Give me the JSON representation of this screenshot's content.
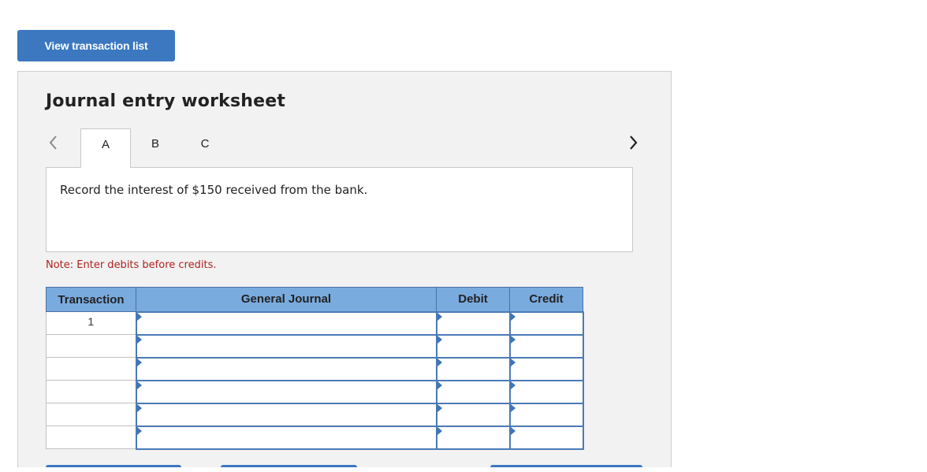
{
  "view_button": {
    "label": "View transaction list"
  },
  "worksheet": {
    "title": "Journal entry worksheet",
    "tabs": [
      {
        "label": "A",
        "active": true
      },
      {
        "label": "B",
        "active": false
      },
      {
        "label": "C",
        "active": false
      }
    ],
    "description": "Record the interest of $150 received from the bank.",
    "note": "Note: Enter debits before credits."
  },
  "journal_table": {
    "headers": {
      "transaction": "Transaction",
      "general_journal": "General Journal",
      "debit": "Debit",
      "credit": "Credit"
    },
    "rows": [
      {
        "transaction": "1",
        "account": "",
        "debit": "",
        "credit": ""
      },
      {
        "transaction": "",
        "account": "",
        "debit": "",
        "credit": ""
      },
      {
        "transaction": "",
        "account": "",
        "debit": "",
        "credit": ""
      },
      {
        "transaction": "",
        "account": "",
        "debit": "",
        "credit": ""
      },
      {
        "transaction": "",
        "account": "",
        "debit": "",
        "credit": ""
      },
      {
        "transaction": "",
        "account": "",
        "debit": "",
        "credit": ""
      }
    ]
  },
  "icons": {
    "prev": "chevron-left-icon",
    "next": "chevron-right-icon"
  },
  "colors": {
    "button_blue": "#3b78c0",
    "header_blue": "#7aabdf",
    "note_red": "#b22222",
    "panel_bg": "#f2f2f2"
  }
}
